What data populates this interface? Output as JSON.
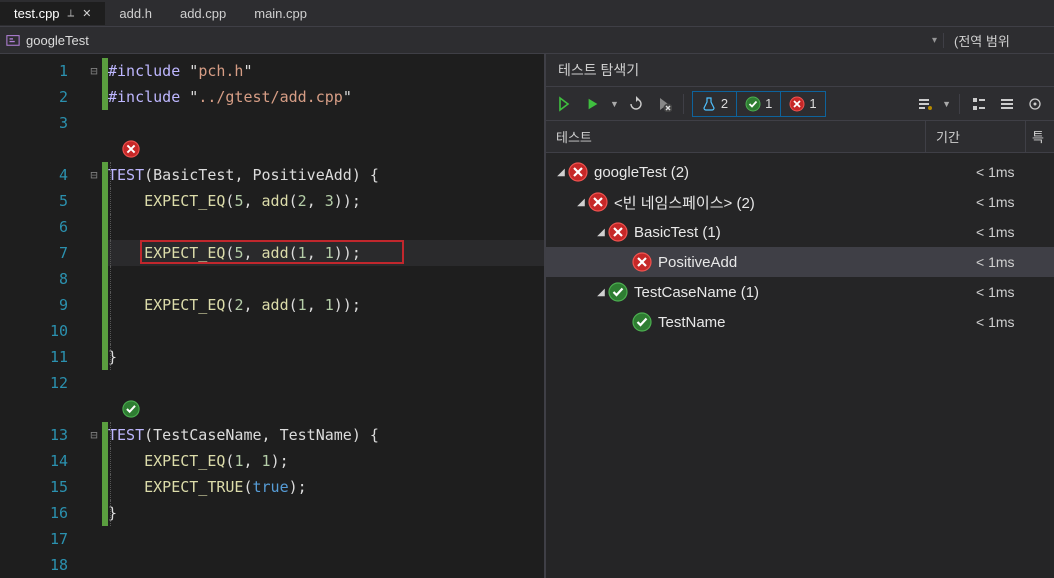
{
  "tabs": [
    {
      "label": "test.cpp",
      "active": true
    },
    {
      "label": "add.h",
      "active": false
    },
    {
      "label": "add.cpp",
      "active": false
    },
    {
      "label": "main.cpp",
      "active": false
    }
  ],
  "scope": {
    "name": "googleTest",
    "right": "(전역 범위"
  },
  "test_panel": {
    "title": "테스트 탐색기",
    "badges": {
      "total": "2",
      "pass": "1",
      "fail": "1"
    },
    "columns": {
      "test": "테스트",
      "duration": "기간",
      "trait": "특"
    },
    "rows": [
      {
        "indent": 0,
        "expand": true,
        "status": "fail",
        "label": "googleTest (2)",
        "dur": "< 1ms"
      },
      {
        "indent": 1,
        "expand": true,
        "status": "fail",
        "label": "<빈 네임스페이스> (2)",
        "dur": "< 1ms"
      },
      {
        "indent": 2,
        "expand": true,
        "status": "fail",
        "label": "BasicTest (1)",
        "dur": "< 1ms"
      },
      {
        "indent": 3,
        "expand": false,
        "status": "fail",
        "label": "PositiveAdd",
        "dur": "< 1ms",
        "selected": true
      },
      {
        "indent": 2,
        "expand": true,
        "status": "pass",
        "label": "TestCaseName (1)",
        "dur": "< 1ms"
      },
      {
        "indent": 3,
        "expand": false,
        "status": "pass",
        "label": "TestName",
        "dur": "< 1ms"
      }
    ]
  },
  "code": {
    "lines": [
      {
        "n": 1,
        "fold": "-",
        "chg": "g",
        "html": [
          [
            "macro",
            "#include"
          ],
          [
            "punc",
            " \""
          ],
          [
            "str",
            "pch.h"
          ],
          [
            "punc",
            "\""
          ]
        ]
      },
      {
        "n": 2,
        "fold": "",
        "chg": "g",
        "html": [
          [
            "macro",
            "#include"
          ],
          [
            "punc",
            " \""
          ],
          [
            "str",
            "../gtest/add.cpp"
          ],
          [
            "punc",
            "\""
          ]
        ]
      },
      {
        "n": 3,
        "fold": "",
        "chg": "",
        "html": []
      },
      {
        "n": "",
        "fold": "",
        "chg": "",
        "status": "fail",
        "html": []
      },
      {
        "n": 4,
        "fold": "-",
        "chg": "g",
        "html": [
          [
            "macro",
            "TEST"
          ],
          [
            "punc",
            "("
          ],
          [
            "ident",
            "BasicTest"
          ],
          [
            "punc",
            ", "
          ],
          [
            "ident",
            "PositiveAdd"
          ],
          [
            "punc",
            ") {"
          ]
        ]
      },
      {
        "n": 5,
        "fold": "",
        "chg": "g",
        "html": [
          [
            "punc",
            "    "
          ],
          [
            "func",
            "EXPECT_EQ"
          ],
          [
            "punc",
            "("
          ],
          [
            "num",
            "5"
          ],
          [
            "punc",
            ", "
          ],
          [
            "func",
            "add"
          ],
          [
            "punc",
            "("
          ],
          [
            "num",
            "2"
          ],
          [
            "punc",
            ", "
          ],
          [
            "num",
            "3"
          ],
          [
            "punc",
            "));"
          ]
        ]
      },
      {
        "n": 6,
        "fold": "",
        "chg": "g",
        "html": []
      },
      {
        "n": 7,
        "fold": "",
        "chg": "g",
        "sel": true,
        "boxed": true,
        "html": [
          [
            "punc",
            "    "
          ],
          [
            "func",
            "EXPECT_EQ"
          ],
          [
            "punc",
            "("
          ],
          [
            "num",
            "5"
          ],
          [
            "punc",
            ", "
          ],
          [
            "func",
            "add"
          ],
          [
            "punc",
            "("
          ],
          [
            "num",
            "1"
          ],
          [
            "punc",
            ", "
          ],
          [
            "num",
            "1"
          ],
          [
            "punc",
            "));"
          ]
        ]
      },
      {
        "n": 8,
        "fold": "",
        "chg": "g",
        "html": []
      },
      {
        "n": 9,
        "fold": "",
        "chg": "g",
        "html": [
          [
            "punc",
            "    "
          ],
          [
            "func",
            "EXPECT_EQ"
          ],
          [
            "punc",
            "("
          ],
          [
            "num",
            "2"
          ],
          [
            "punc",
            ", "
          ],
          [
            "func",
            "add"
          ],
          [
            "punc",
            "("
          ],
          [
            "num",
            "1"
          ],
          [
            "punc",
            ", "
          ],
          [
            "num",
            "1"
          ],
          [
            "punc",
            "));"
          ]
        ]
      },
      {
        "n": 10,
        "fold": "",
        "chg": "g",
        "html": []
      },
      {
        "n": 11,
        "fold": "",
        "chg": "g",
        "html": [
          [
            "punc",
            "}"
          ]
        ]
      },
      {
        "n": 12,
        "fold": "",
        "chg": "",
        "html": []
      },
      {
        "n": "",
        "fold": "",
        "chg": "",
        "status": "pass",
        "html": []
      },
      {
        "n": 13,
        "fold": "-",
        "chg": "g",
        "html": [
          [
            "macro",
            "TEST"
          ],
          [
            "punc",
            "("
          ],
          [
            "ident",
            "TestCaseName"
          ],
          [
            "punc",
            ", "
          ],
          [
            "ident",
            "TestName"
          ],
          [
            "punc",
            ") {"
          ]
        ]
      },
      {
        "n": 14,
        "fold": "",
        "chg": "g",
        "html": [
          [
            "punc",
            "    "
          ],
          [
            "func",
            "EXPECT_EQ"
          ],
          [
            "punc",
            "("
          ],
          [
            "num",
            "1"
          ],
          [
            "punc",
            ", "
          ],
          [
            "num",
            "1"
          ],
          [
            "punc",
            ");"
          ]
        ]
      },
      {
        "n": 15,
        "fold": "",
        "chg": "g",
        "html": [
          [
            "punc",
            "    "
          ],
          [
            "func",
            "EXPECT_TRUE"
          ],
          [
            "punc",
            "("
          ],
          [
            "kw",
            "true"
          ],
          [
            "punc",
            ");"
          ]
        ]
      },
      {
        "n": 16,
        "fold": "",
        "chg": "g",
        "html": [
          [
            "punc",
            "}"
          ]
        ]
      },
      {
        "n": 17,
        "fold": "",
        "chg": "",
        "html": []
      },
      {
        "n": 18,
        "fold": "",
        "chg": "",
        "html": []
      }
    ]
  }
}
